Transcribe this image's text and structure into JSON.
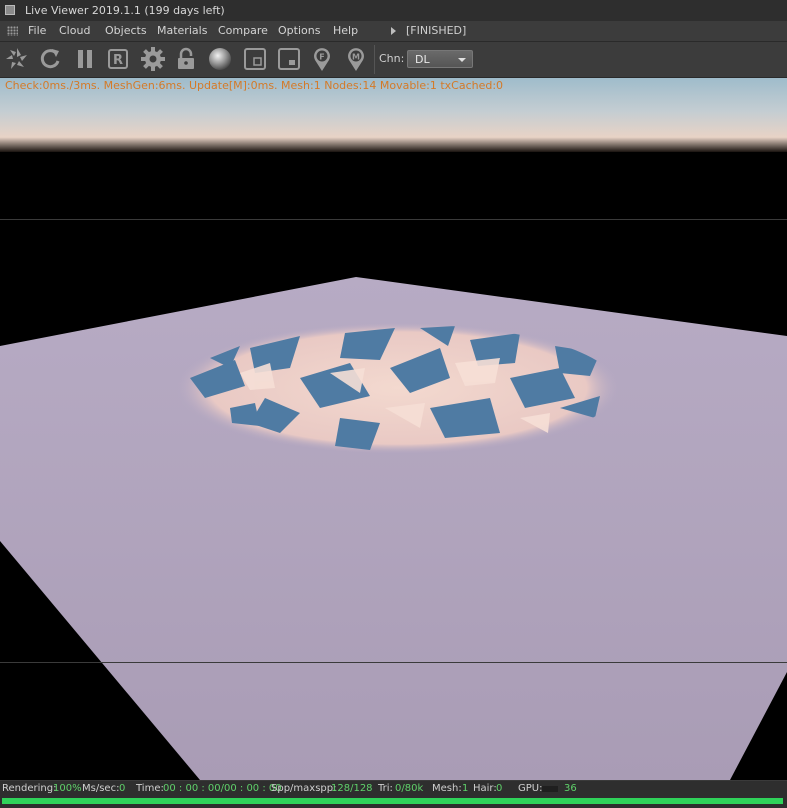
{
  "window": {
    "title": "Live Viewer 2019.1.1 (199 days left)"
  },
  "menu": {
    "items": [
      "File",
      "Cloud",
      "Objects",
      "Materials",
      "Compare",
      "Options",
      "Help"
    ],
    "status": "[FINISHED]"
  },
  "toolbar": {
    "buttons": [
      {
        "name": "send-scene-icon"
      },
      {
        "name": "restart-icon"
      },
      {
        "name": "pause-icon"
      },
      {
        "name": "region-render-icon",
        "glyph": "R"
      },
      {
        "name": "settings-gear-icon"
      },
      {
        "name": "lock-icon"
      },
      {
        "name": "material-sphere-icon"
      },
      {
        "name": "viewport-region-icon"
      },
      {
        "name": "film-region-icon"
      },
      {
        "name": "focus-picker-icon",
        "glyph": "F"
      },
      {
        "name": "material-picker-icon",
        "glyph": "M"
      }
    ],
    "channel_label": "Chn:",
    "channel_value": "DL"
  },
  "viewport": {
    "stats": "Check:0ms./3ms. MeshGen:6ms. Update[M]:0ms. Mesh:1 Nodes:14 Movable:1 txCached:0"
  },
  "statusbar": {
    "rendering_label": "Rendering:",
    "rendering_value": "100%",
    "mssec_label": "Ms/sec:",
    "mssec_value": "0",
    "time_label": "Time:",
    "time_value": "00 : 00 : 00/00 : 00 : 00",
    "spp_label": "Spp/maxspp:",
    "spp_value": "128/128",
    "tri_label": "Tri:",
    "tri_value": "0/80k",
    "mesh_label": "Mesh:",
    "mesh_value": "1",
    "hair_label": "Hair:",
    "hair_value": "0",
    "gpu_label": "GPU:",
    "gpu_value": "36",
    "progress": 1.0
  },
  "colors": {
    "render_progress": "#2fd35a",
    "stats_text": "#d47a28",
    "status_value": "#5fd06a"
  }
}
